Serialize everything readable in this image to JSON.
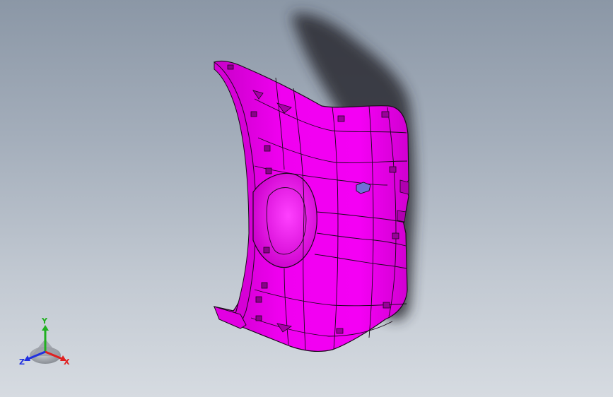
{
  "viewport": {
    "background_top": "#8b97a6",
    "background_bottom": "#d6dbe1"
  },
  "model": {
    "part_color": "#ee00ee",
    "edge_color": "#1a0a1a",
    "highlight_color": "#6f6fd8"
  },
  "triad": {
    "x_label": "X",
    "y_label": "Y",
    "z_label": "Z",
    "x_color": "#e02020",
    "y_color": "#20b020",
    "z_color": "#2030e0"
  }
}
